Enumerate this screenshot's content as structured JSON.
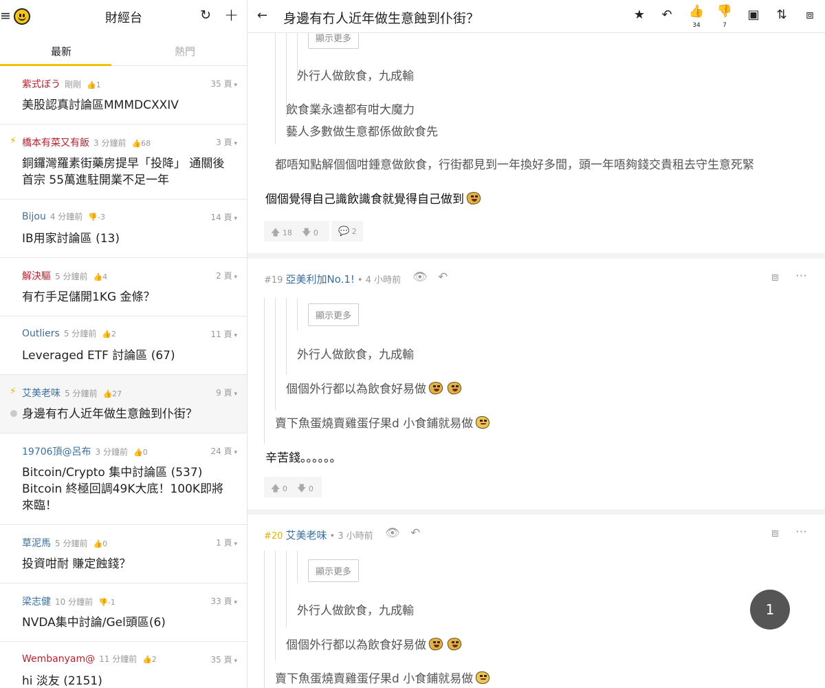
{
  "app": {
    "title": "財經台"
  },
  "icons": {
    "menu": "hamburger-icon",
    "logo": "smiley-icon",
    "refresh": "refresh-icon",
    "add": "plus-icon"
  },
  "tabs": [
    {
      "label": "最新"
    },
    {
      "label": "熱門"
    }
  ],
  "threads": [
    {
      "author": "紫式ぼう",
      "time": "剛剛",
      "votes": "1",
      "vote_type": "up",
      "pages": "35 頁",
      "title": "美股認真討論區MMMDCXXIV",
      "author_color": "red"
    },
    {
      "author": "橋本有菜又有飯",
      "time": "3 分鐘前",
      "votes": "68",
      "vote_type": "up",
      "pages": "3 頁",
      "title": "銅鑼灣羅素街藥房提早「投降」 通關後首宗 55萬進駐開業不足一年",
      "author_color": "red",
      "hot": true
    },
    {
      "author": "Bijou",
      "time": "4 分鐘前",
      "votes": "-3",
      "vote_type": "down",
      "pages": "14 頁",
      "title": "IB用家討論區 (13)",
      "author_color": "blue"
    },
    {
      "author": "解決驅",
      "time": "5 分鐘前",
      "votes": "4",
      "vote_type": "up",
      "pages": "2 頁",
      "title": "有冇手足儲開1KG 金條？",
      "author_color": "red"
    },
    {
      "author": "Outliers",
      "time": "5 分鐘前",
      "votes": "2",
      "vote_type": "up",
      "pages": "11 頁",
      "title": "Leveraged ETF 討論區 (67)",
      "author_color": "blue"
    },
    {
      "author": "艾美老味",
      "time": "5 分鐘前",
      "votes": "27",
      "vote_type": "up",
      "pages": "9 頁",
      "title": "身邊有冇人近年做生意蝕到仆街？",
      "author_color": "blue",
      "hot": true,
      "active": true
    },
    {
      "author": "19706頂@呂布",
      "time": "3 分鐘前",
      "votes": "0",
      "vote_type": "up",
      "pages": "24 頁",
      "title": "Bitcoin/Crypto 集中討論區 (537) Bitcoin 終極回調49K大底！100K即將來臨！",
      "author_color": "blue"
    },
    {
      "author": "草泥馬",
      "time": "5 分鐘前",
      "votes": "0",
      "vote_type": "up",
      "pages": "1 頁",
      "title": "投資咁耐 賺定蝕錢？",
      "author_color": "blue"
    },
    {
      "author": "梁志健",
      "time": "10 分鐘前",
      "votes": "-1",
      "vote_type": "down",
      "pages": "33 頁",
      "title": "NVDA集中討論/Gel頭區(6)",
      "author_color": "blue"
    },
    {
      "author": "Wembanyam@",
      "time": "11 分鐘前",
      "votes": "2",
      "vote_type": "up",
      "pages": "35 頁",
      "title": "hi 淡友 (2151)",
      "author_color": "red"
    }
  ],
  "thread_view": {
    "title": "身邊有冇人近年做生意蝕到仆街？",
    "like_count": "34",
    "dislike_count": "7",
    "toolbar_icons": [
      "star-icon",
      "reply-icon",
      "thumbs-up-icon",
      "thumbs-down-icon",
      "image-icon",
      "sort-icon",
      "share-icon"
    ],
    "show_more_label": "顯示更多",
    "post18": {
      "quote_deep": "外行人做飲食，九成輸",
      "quote_l2a": "飲食業永遠都有咁大魔力",
      "quote_l2b": "藝人多數做生意都係做飲食先",
      "quote_l1": "都唔知點解個個咁鍾意做飲食，行街都見到一年換好多間，頭一年唔夠錢交貴租去守生意死緊",
      "body": "個個覺得自己識飲識食就覺得自己做到",
      "up": "18",
      "down": "0",
      "comments": "2"
    },
    "post19": {
      "number": "#19",
      "author": "亞美利加No.1!",
      "time": "4 小時前",
      "quote_deep": "外行人做飲食，九成輸",
      "quote_l2": "個個外行都以為飲食好易做",
      "quote_l1": "賣下魚蛋燒賣雞蛋仔果d 小食鋪就易做",
      "body": "辛苦錢。。。。。。",
      "up": "0",
      "down": "0"
    },
    "post20": {
      "number": "#20",
      "author": "艾美老味",
      "time": "3 小時前",
      "quote_deep": "外行人做飲食，九成輸",
      "quote_l2": "個個外行都以為飲食好易做",
      "quote_l1": "賣下魚蛋燒賣雞蛋仔果d 小食鋪就易做"
    },
    "page_indicator": "1"
  }
}
